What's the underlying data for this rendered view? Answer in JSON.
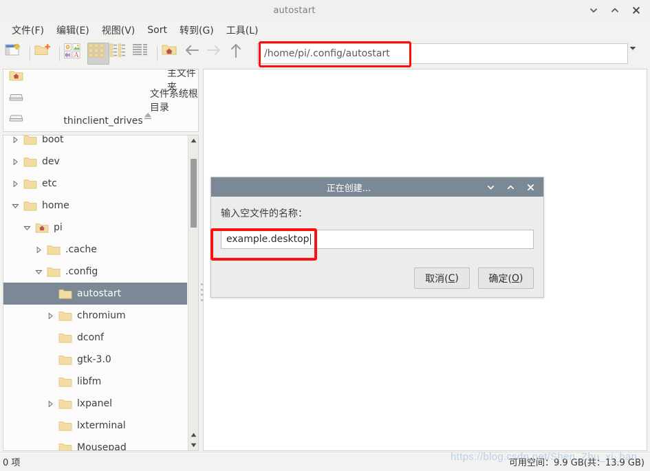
{
  "window": {
    "title": "autostart",
    "controls": [
      {
        "name": "minimize-button",
        "glyph": "chevron-down"
      },
      {
        "name": "maximize-button",
        "glyph": "chevron-up"
      },
      {
        "name": "close-button",
        "glyph": "cross"
      }
    ]
  },
  "menubar": {
    "items": [
      {
        "label": "文件(F)",
        "name": "menu-file"
      },
      {
        "label": "编辑(E)",
        "name": "menu-edit"
      },
      {
        "label": "视图(V)",
        "name": "menu-view"
      },
      {
        "label": "Sort",
        "name": "menu-sort"
      },
      {
        "label": "转到(G)",
        "name": "menu-go"
      },
      {
        "label": "工具(L)",
        "name": "menu-tools"
      }
    ]
  },
  "toolbar": {
    "buttons": [
      {
        "name": "new-tab-icon",
        "title": "新建标签"
      },
      {
        "name": "new-folder-icon",
        "title": "新建文件夹"
      },
      {
        "name": "show-thumbnails-icon",
        "title": "显示缩略图"
      },
      {
        "name": "icon-view-icon",
        "title": "图标视图",
        "active": true
      },
      {
        "name": "compact-view-icon",
        "title": "紧凑视图"
      },
      {
        "name": "detailed-list-view-icon",
        "title": "详细列表视图"
      },
      {
        "name": "home-icon",
        "title": "主文件夹"
      },
      {
        "name": "back-arrow-icon",
        "title": "后退"
      },
      {
        "name": "forward-arrow-icon",
        "title": "前进",
        "disabled": true
      },
      {
        "name": "up-arrow-icon",
        "title": "上一级"
      }
    ]
  },
  "pathbar": {
    "value": "/home/pi/.config/autostart",
    "placeholder": "",
    "dropdown_icon": "chevron-down-icon"
  },
  "places": {
    "items": [
      {
        "label": "主文件夹",
        "icon": "home-folder-icon",
        "name": "place-home"
      },
      {
        "label": "文件系统根目录",
        "icon": "drive-icon",
        "name": "place-filesystem-root"
      },
      {
        "label": "thinclient_drives",
        "icon": "drive-icon",
        "name": "place-thinclient-drives",
        "eject": true
      }
    ]
  },
  "tree": {
    "items": [
      {
        "label": "boot",
        "indent": 0,
        "twisty": "collapsed",
        "icon": "folder-icon",
        "selected": false
      },
      {
        "label": "dev",
        "indent": 0,
        "twisty": "collapsed",
        "icon": "folder-icon",
        "selected": false
      },
      {
        "label": "etc",
        "indent": 0,
        "twisty": "collapsed",
        "icon": "folder-icon",
        "selected": false
      },
      {
        "label": "home",
        "indent": 0,
        "twisty": "expanded",
        "icon": "folder-icon",
        "selected": false
      },
      {
        "label": "pi",
        "indent": 1,
        "twisty": "expanded",
        "icon": "home-folder-icon",
        "selected": false
      },
      {
        "label": ".cache",
        "indent": 2,
        "twisty": "collapsed",
        "icon": "folder-icon",
        "selected": false
      },
      {
        "label": ".config",
        "indent": 2,
        "twisty": "expanded",
        "icon": "folder-icon",
        "selected": false
      },
      {
        "label": "autostart",
        "indent": 3,
        "twisty": "none",
        "icon": "folder-icon",
        "selected": true
      },
      {
        "label": "chromium",
        "indent": 3,
        "twisty": "collapsed",
        "icon": "folder-icon",
        "selected": false
      },
      {
        "label": "dconf",
        "indent": 3,
        "twisty": "none",
        "icon": "folder-icon",
        "selected": false
      },
      {
        "label": "gtk-3.0",
        "indent": 3,
        "twisty": "none",
        "icon": "folder-icon",
        "selected": false
      },
      {
        "label": "libfm",
        "indent": 3,
        "twisty": "none",
        "icon": "folder-icon",
        "selected": false
      },
      {
        "label": "lxpanel",
        "indent": 3,
        "twisty": "collapsed",
        "icon": "folder-icon",
        "selected": false
      },
      {
        "label": "lxterminal",
        "indent": 3,
        "twisty": "none",
        "icon": "folder-icon",
        "selected": false
      },
      {
        "label": "Mousepad",
        "indent": 3,
        "twisty": "none",
        "icon": "folder-icon",
        "selected": false
      }
    ]
  },
  "statusbar": {
    "left": "0 项",
    "right": "可用空间：9.9 GB(共：13.9 GB)"
  },
  "watermark": {
    "text": "https://blog.csdn.net/Shen_Zhu_xi_han"
  },
  "dialog": {
    "title": "正在创建...",
    "prompt": "输入空文件的名称：",
    "input_value": "example.desktop",
    "input_placeholder": "",
    "buttons": [
      {
        "name": "cancel-button",
        "pre": "取消(",
        "key": "C",
        "post": ")"
      },
      {
        "name": "ok-button",
        "pre": "确定(",
        "key": "O",
        "post": ")"
      }
    ],
    "controls": [
      {
        "name": "dialog-minimize-button",
        "glyph": "chevron-down"
      },
      {
        "name": "dialog-maximize-button",
        "glyph": "chevron-up"
      },
      {
        "name": "dialog-close-button",
        "glyph": "cross"
      }
    ]
  },
  "annotations": {
    "path_highlight_color": "#ff0d0d",
    "filename_highlight_color": "#fb1111"
  },
  "colors": {
    "selection": "#7b8896",
    "dialog_titlebar": "#7b8896",
    "chrome": "#f2f2f0",
    "folder": "#f5dfa0"
  }
}
